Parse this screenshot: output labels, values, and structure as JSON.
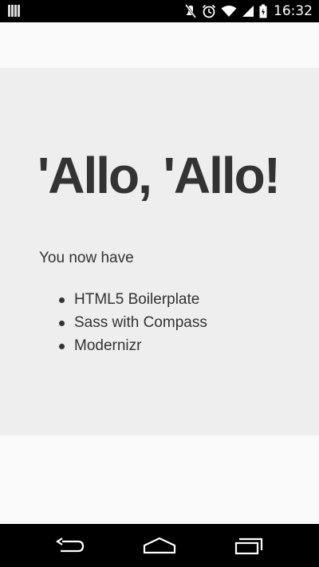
{
  "status_bar": {
    "time": "16:32",
    "icons": [
      "notification-icon",
      "mute-icon",
      "alarm-icon",
      "wifi-icon",
      "signal-icon",
      "battery-icon"
    ]
  },
  "hero": {
    "title": "'Allo, 'Allo!",
    "lead": "You now have",
    "items": [
      {
        "label": "HTML5 Boilerplate"
      },
      {
        "label": "Sass with Compass"
      },
      {
        "label": "Modernizr"
      }
    ]
  },
  "nav_bar": {
    "buttons": [
      "back-icon",
      "home-icon",
      "recent-apps-icon"
    ]
  },
  "colors": {
    "hero_background": "#eeeeee",
    "page_background": "#fafafa",
    "text": "#333333",
    "system_bar": "#000000"
  }
}
